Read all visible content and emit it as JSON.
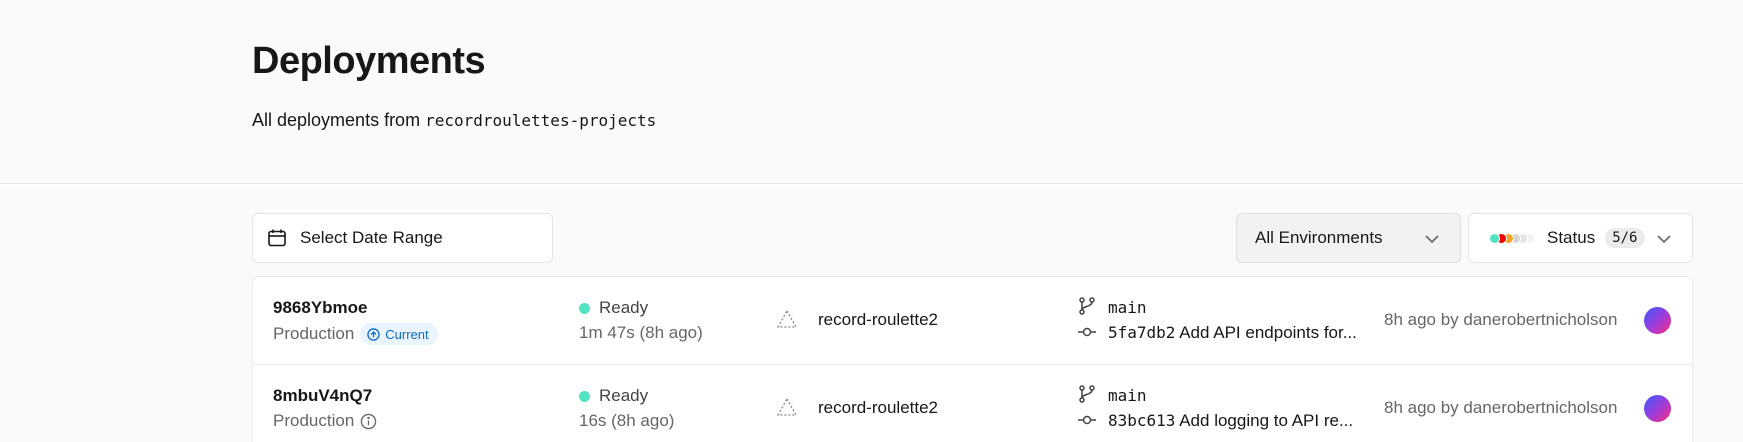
{
  "header": {
    "title": "Deployments",
    "subtitle_prefix": "All deployments from ",
    "scope": "recordroulettes-projects"
  },
  "filters": {
    "date_range_label": "Select Date Range",
    "environment_label": "All Environments",
    "status_label": "Status",
    "status_count": "5/6",
    "status_colors": [
      "#50e3c2",
      "#ee0000",
      "#f5a623",
      "#d4d4d4",
      "#e5e5e5",
      "#f2f2f2"
    ]
  },
  "deployments": [
    {
      "id": "9868Ybmoe",
      "environment": "Production",
      "badge": "Current",
      "status": "Ready",
      "duration": "1m 47s (8h ago)",
      "project": "record-roulette2",
      "branch": "main",
      "commit_hash": "5fa7db2",
      "commit_message": " Add API endpoints for...",
      "meta": "8h ago by danerobertnicholson"
    },
    {
      "id": "8mbuV4nQ7",
      "environment": "Production",
      "status": "Ready",
      "duration": "16s (8h ago)",
      "project": "record-roulette2",
      "branch": "main",
      "commit_hash": "83bc613",
      "commit_message": " Add logging to API re...",
      "meta": "8h ago by danerobertnicholson"
    }
  ]
}
